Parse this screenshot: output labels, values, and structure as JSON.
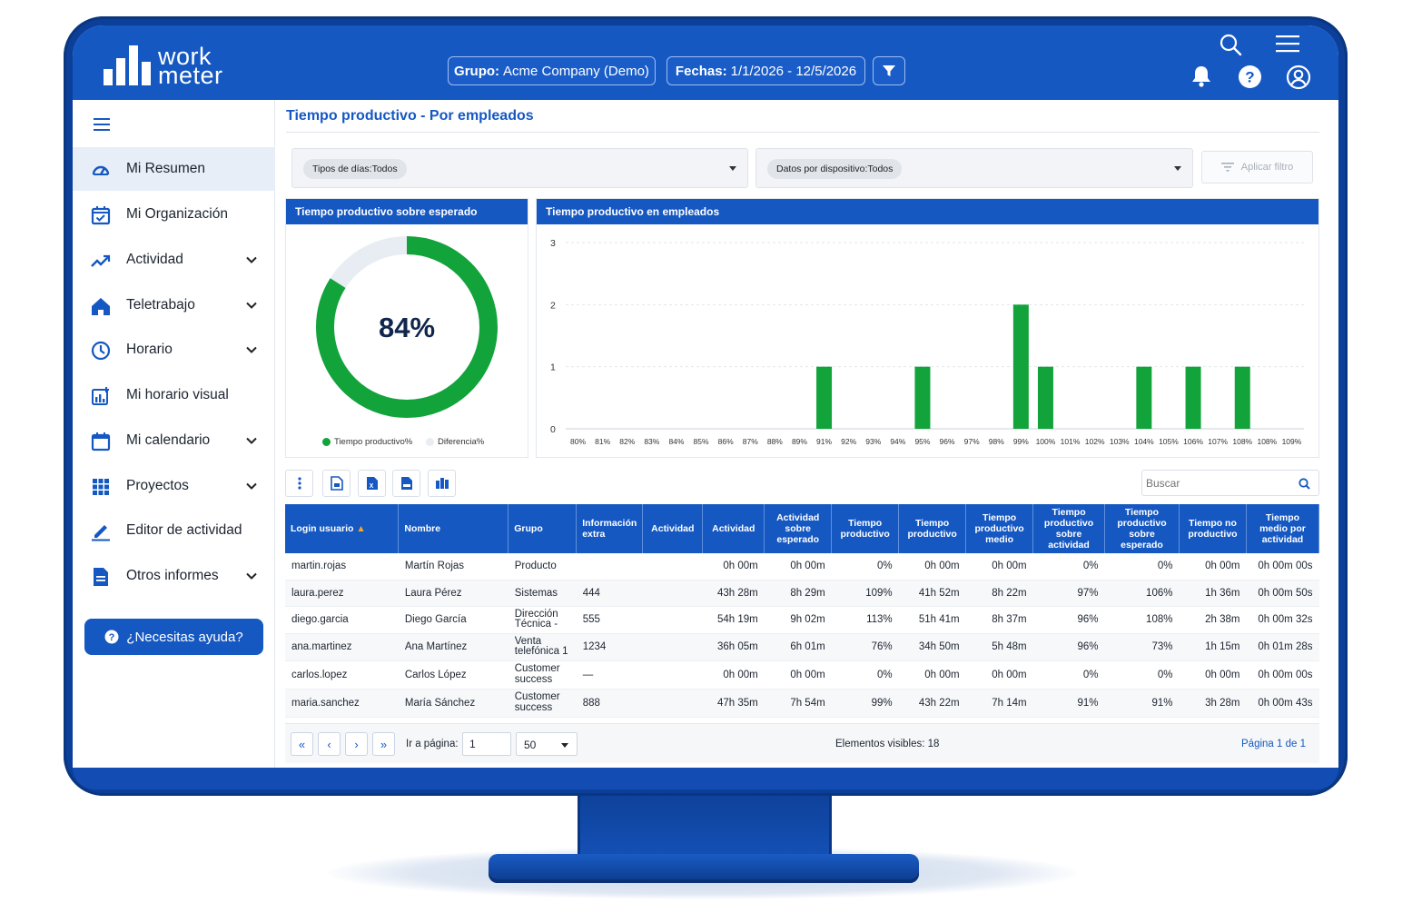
{
  "brand": {
    "line1": "work",
    "line2": "meter"
  },
  "header": {
    "group_label": "Grupo:",
    "group_value": "Acme Company (Demo)",
    "dates_label": "Fechas:",
    "dates_value": "1/1/2026 - 12/5/2026",
    "icons": [
      "filter-icon",
      "search-icon",
      "menu-icon",
      "bell-icon",
      "help-icon",
      "user-icon"
    ]
  },
  "sidebar": {
    "items": [
      {
        "label": "Mi Resumen",
        "icon": "gauge-icon",
        "active": true
      },
      {
        "label": "Mi Organización",
        "icon": "calendar-check-icon"
      },
      {
        "label": "Actividad",
        "icon": "trend-icon",
        "expandable": true
      },
      {
        "label": "Teletrabajo",
        "icon": "home-icon",
        "expandable": true
      },
      {
        "label": "Horario",
        "icon": "clock-icon",
        "expandable": true
      },
      {
        "label": "Mi horario visual",
        "icon": "chart-add-icon"
      },
      {
        "label": "Mi calendario",
        "icon": "calendar-icon",
        "expandable": true
      },
      {
        "label": "Proyectos",
        "icon": "grid-icon",
        "expandable": true
      },
      {
        "label": "Editor de actividad",
        "icon": "pencil-icon"
      },
      {
        "label": "Otros informes",
        "icon": "document-icon",
        "expandable": true
      }
    ],
    "help_label": "¿Necesitas ayuda?"
  },
  "main": {
    "title": "Tiempo productivo - Por empleados",
    "filters": {
      "days_chip": "Tipos de días:Todos",
      "device_chip": "Datos por dispositivo:Todos",
      "apply_label": "Aplicar filtro"
    },
    "donut_panel": {
      "title": "Tiempo productivo sobre esperado",
      "value_label": "84%",
      "value": 84,
      "legend": [
        "Tiempo productivo%",
        "Diferencia%"
      ],
      "colors": {
        "productive": "#12a33b",
        "difference": "#e8edf4"
      }
    },
    "bar_panel": {
      "title": "Tiempo productivo en empleados"
    },
    "search_placeholder": "Buscar",
    "table": {
      "headers": [
        "Login usuario",
        "Nombre",
        "Grupo",
        "Información extra",
        "Actividad",
        "Actividad",
        "Actividad sobre esperado",
        "Tiempo productivo",
        "Tiempo productivo",
        "Tiempo productivo medio",
        "Tiempo productivo sobre actividad",
        "Tiempo productivo sobre esperado",
        "Tiempo no productivo",
        "Tiempo medio por actividad"
      ],
      "rows": [
        [
          "martin.rojas",
          "Martín Rojas",
          "Producto",
          "",
          "",
          "0h 00m",
          "0h 00m",
          "0%",
          "0h 00m",
          "0h 00m",
          "0%",
          "0%",
          "0h 00m",
          "0h 00m 00s"
        ],
        [
          "laura.perez",
          "Laura Pérez",
          "Sistemas",
          "444",
          "",
          "43h 28m",
          "8h 29m",
          "109%",
          "41h 52m",
          "8h 22m",
          "97%",
          "106%",
          "1h 36m",
          "0h 00m 50s"
        ],
        [
          "diego.garcia",
          "Diego García",
          "Dirección Técnica  -",
          "555",
          "",
          "54h 19m",
          "9h 02m",
          "113%",
          "51h 41m",
          "8h 37m",
          "96%",
          "108%",
          "2h 38m",
          "0h 00m 32s"
        ],
        [
          "ana.martinez",
          "Ana Martínez",
          "Venta telefónica 1",
          "1234",
          "",
          "36h 05m",
          "6h 01m",
          "76%",
          "34h 50m",
          "5h 48m",
          "96%",
          "73%",
          "1h 15m",
          "0h 01m 28s"
        ],
        [
          "carlos.lopez",
          "Carlos López",
          "Customer success",
          "—",
          "",
          "0h 00m",
          "0h 00m",
          "0%",
          "0h 00m",
          "0h 00m",
          "0%",
          "0%",
          "0h 00m",
          "0h 00m 00s"
        ],
        [
          "maria.sanchez",
          "María Sánchez",
          "Customer success",
          "888",
          "",
          "47h 35m",
          "7h 54m",
          "99%",
          "43h 22m",
          "7h 14m",
          "91%",
          "91%",
          "3h 28m",
          "0h 00m 43s"
        ]
      ]
    },
    "pager": {
      "goto_label": "Ir a página:",
      "page_input": "1",
      "page_size": "50",
      "visible_label": "Elementos visibles: 18",
      "page_label": "Página 1 de 1",
      "buttons": [
        "«",
        "‹",
        "›",
        "»"
      ]
    }
  },
  "chart_data": {
    "type": "bar",
    "title": "Tiempo productivo en empleados",
    "categories": [
      "80%",
      "81%",
      "82%",
      "83%",
      "84%",
      "85%",
      "86%",
      "87%",
      "88%",
      "89%",
      "91%",
      "92%",
      "93%",
      "94%",
      "95%",
      "96%",
      "97%",
      "98%",
      "99%",
      "100%",
      "101%",
      "102%",
      "103%",
      "104%",
      "105%",
      "106%",
      "107%",
      "108%",
      "108%",
      "109%"
    ],
    "values": [
      0,
      0,
      0,
      0,
      0,
      0,
      0,
      0,
      0,
      0,
      1,
      0,
      0,
      0,
      1,
      0,
      0,
      0,
      2,
      1,
      0,
      0,
      0,
      1,
      0,
      1,
      0,
      1,
      0,
      0
    ],
    "yticks": [
      0,
      1,
      2,
      3
    ],
    "ylim": [
      0,
      3
    ],
    "grid": true,
    "color": "#12a33b"
  }
}
